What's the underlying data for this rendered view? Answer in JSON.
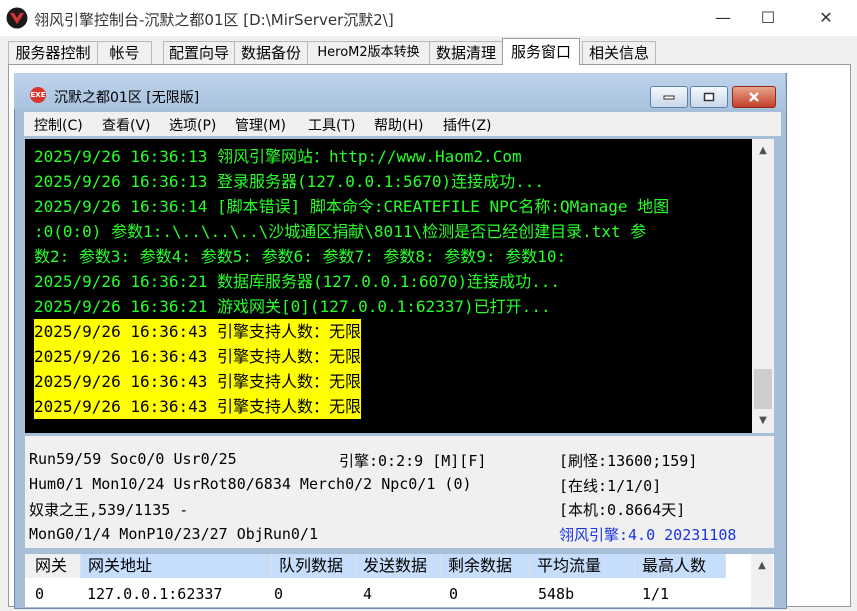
{
  "window": {
    "title": "翎风引擎控制台-沉默之都01区 [D:\\MirServer沉默2\\]",
    "minimize_glyph": "—",
    "maximize_glyph": "☐",
    "close_glyph": "✕"
  },
  "tabs": [
    {
      "label": "服务器控制"
    },
    {
      "label": "帐号"
    },
    {
      "label": "配置向导"
    },
    {
      "label": "数据备份"
    },
    {
      "label": "HeroM2版本转换"
    },
    {
      "label": "数据清理"
    },
    {
      "label": "服务窗口"
    },
    {
      "label": "相关信息"
    }
  ],
  "active_tab": "服务窗口",
  "mdi": {
    "icon_text": "EXE",
    "caption": "沉默之都01区 [无限版]"
  },
  "menu": [
    {
      "label": "控制(C)"
    },
    {
      "label": "查看(V)"
    },
    {
      "label": "选项(P)"
    },
    {
      "label": "管理(M)"
    },
    {
      "label": "工具(T)"
    },
    {
      "label": "帮助(H)"
    },
    {
      "label": "插件(Z)"
    }
  ],
  "console_lines": [
    {
      "text": "2025/9/26 16:36:13 翎风引擎网站：http://www.Haom2.Com",
      "highlight": false
    },
    {
      "text": "2025/9/26 16:36:13 登录服务器(127.0.0.1:5670)连接成功...",
      "highlight": false
    },
    {
      "text": "2025/9/26 16:36:14 [脚本错误] 脚本命令:CREATEFILE NPC名称:QManage 地图",
      "highlight": false
    },
    {
      "text": ":0(0:0) 参数1:.\\..\\..\\..\\沙城通区捐献\\8011\\检测是否已经创建目录.txt 参",
      "highlight": false
    },
    {
      "text": "数2: 参数3: 参数4: 参数5: 参数6: 参数7: 参数8: 参数9: 参数10:",
      "highlight": false
    },
    {
      "text": "2025/9/26 16:36:21 数据库服务器(127.0.0.1:6070)连接成功...",
      "highlight": false
    },
    {
      "text": "2025/9/26 16:36:21 游戏网关[0](127.0.0.1:62337)已打开...",
      "highlight": false
    },
    {
      "text": "2025/9/26 16:36:43 引擎支持人数：无限",
      "highlight": true
    },
    {
      "text": "2025/9/26 16:36:43 引擎支持人数：无限",
      "highlight": true
    },
    {
      "text": "2025/9/26 16:36:43 引擎支持人数：无限",
      "highlight": true
    },
    {
      "text": "2025/9/26 16:36:43 引擎支持人数：无限",
      "highlight": true
    }
  ],
  "console_colors": {
    "text": "#27ff27",
    "background": "#000000",
    "highlight_bg": "#ffff00"
  },
  "status": {
    "run": "Run59/59 Soc0/0 Usr0/25",
    "engine": "引擎:0:2:9 [M][F]",
    "monster": "[刷怪:13600;159]",
    "hum": "Hum0/1 Mon10/24 UsrRot80/6834 Merch0/2 Npc0/1 (0)",
    "online": "[在线:1/1/0]",
    "king": "奴隶之王,539/1135 -",
    "local": "[本机:0.8664天]",
    "mon": "MonG0/1/4 MonP10/23/27 ObjRun0/1",
    "version": "翎风引擎:4.0 20231108"
  },
  "gateway_table": {
    "headers": [
      "网关",
      "网关地址",
      "队列数据",
      "发送数据",
      "剩余数据",
      "平均流量",
      "最高人数"
    ],
    "rows": [
      [
        "0",
        "127.0.0.1:62337",
        "0",
        "4",
        "0",
        "548b",
        "1/1"
      ]
    ]
  }
}
